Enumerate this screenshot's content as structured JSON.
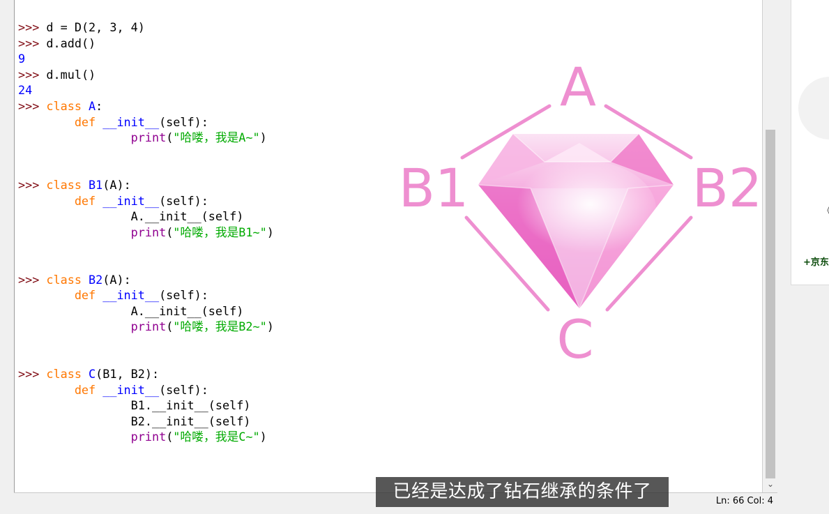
{
  "shell": {
    "prompt": ">>>",
    "lines": [
      {
        "parts": [
          {
            "t": "p",
            "s": ">>> "
          },
          {
            "t": "n",
            "s": "d = D(2, 3, 4)"
          }
        ]
      },
      {
        "parts": [
          {
            "t": "p",
            "s": ">>> "
          },
          {
            "t": "n",
            "s": "d.add()"
          }
        ]
      },
      {
        "parts": [
          {
            "t": "out",
            "s": "9"
          }
        ]
      },
      {
        "parts": [
          {
            "t": "p",
            "s": ">>> "
          },
          {
            "t": "n",
            "s": "d.mul()"
          }
        ]
      },
      {
        "parts": [
          {
            "t": "out",
            "s": "24"
          }
        ]
      },
      {
        "parts": [
          {
            "t": "p",
            "s": ">>> "
          },
          {
            "t": "kw",
            "s": "class "
          },
          {
            "t": "def",
            "s": "A"
          },
          {
            "t": "n",
            "s": ":"
          }
        ]
      },
      {
        "parts": [
          {
            "t": "n",
            "s": "        "
          },
          {
            "t": "kw",
            "s": "def "
          },
          {
            "t": "def",
            "s": "__init__"
          },
          {
            "t": "n",
            "s": "(self):"
          }
        ]
      },
      {
        "parts": [
          {
            "t": "n",
            "s": "                "
          },
          {
            "t": "bi",
            "s": "print"
          },
          {
            "t": "n",
            "s": "("
          },
          {
            "t": "str",
            "s": "\"哈喽，我是A~\""
          },
          {
            "t": "n",
            "s": ")"
          }
        ]
      },
      {
        "parts": []
      },
      {
        "parts": []
      },
      {
        "parts": [
          {
            "t": "p",
            "s": ">>> "
          },
          {
            "t": "kw",
            "s": "class "
          },
          {
            "t": "def",
            "s": "B1"
          },
          {
            "t": "n",
            "s": "(A):"
          }
        ]
      },
      {
        "parts": [
          {
            "t": "n",
            "s": "        "
          },
          {
            "t": "kw",
            "s": "def "
          },
          {
            "t": "def",
            "s": "__init__"
          },
          {
            "t": "n",
            "s": "(self):"
          }
        ]
      },
      {
        "parts": [
          {
            "t": "n",
            "s": "                A.__init__(self)"
          }
        ]
      },
      {
        "parts": [
          {
            "t": "n",
            "s": "                "
          },
          {
            "t": "bi",
            "s": "print"
          },
          {
            "t": "n",
            "s": "("
          },
          {
            "t": "str",
            "s": "\"哈喽，我是B1~\""
          },
          {
            "t": "n",
            "s": ")"
          }
        ]
      },
      {
        "parts": []
      },
      {
        "parts": []
      },
      {
        "parts": [
          {
            "t": "p",
            "s": ">>> "
          },
          {
            "t": "kw",
            "s": "class "
          },
          {
            "t": "def",
            "s": "B2"
          },
          {
            "t": "n",
            "s": "(A):"
          }
        ]
      },
      {
        "parts": [
          {
            "t": "n",
            "s": "        "
          },
          {
            "t": "kw",
            "s": "def "
          },
          {
            "t": "def",
            "s": "__init__"
          },
          {
            "t": "n",
            "s": "(self):"
          }
        ]
      },
      {
        "parts": [
          {
            "t": "n",
            "s": "                A.__init__(self)"
          }
        ]
      },
      {
        "parts": [
          {
            "t": "n",
            "s": "                "
          },
          {
            "t": "bi",
            "s": "print"
          },
          {
            "t": "n",
            "s": "("
          },
          {
            "t": "str",
            "s": "\"哈喽，我是B2~\""
          },
          {
            "t": "n",
            "s": ")"
          }
        ]
      },
      {
        "parts": []
      },
      {
        "parts": []
      },
      {
        "parts": [
          {
            "t": "p",
            "s": ">>> "
          },
          {
            "t": "kw",
            "s": "class "
          },
          {
            "t": "def",
            "s": "C"
          },
          {
            "t": "n",
            "s": "(B1, B2):"
          }
        ]
      },
      {
        "parts": [
          {
            "t": "n",
            "s": "        "
          },
          {
            "t": "kw",
            "s": "def "
          },
          {
            "t": "def",
            "s": "__init__"
          },
          {
            "t": "n",
            "s": "(self):"
          }
        ]
      },
      {
        "parts": [
          {
            "t": "n",
            "s": "                B1.__init__(self)"
          }
        ]
      },
      {
        "parts": [
          {
            "t": "n",
            "s": "                B2.__init__(self)"
          }
        ]
      },
      {
        "parts": [
          {
            "t": "n",
            "s": "                "
          },
          {
            "t": "bi",
            "s": "print"
          },
          {
            "t": "n",
            "s": "("
          },
          {
            "t": "str",
            "s": "\"哈喽，我是C~\""
          },
          {
            "t": "n",
            "s": ")"
          }
        ]
      },
      {
        "parts": []
      },
      {
        "parts": []
      },
      {
        "parts": []
      },
      {
        "parts": [
          {
            "t": "p",
            "s": ">>>"
          }
        ]
      }
    ]
  },
  "diagram": {
    "top": "A",
    "left": "B1",
    "right": "B2",
    "bottom": "C",
    "color": "#ee8fd0"
  },
  "subtitle": "已经是达成了钻石继承的条件了",
  "status": {
    "position": "Ln: 66  Col: 4"
  },
  "right_panel": {
    "glyph": "《",
    "label": "+京东"
  },
  "colors": {
    "prompt": "#7f0a12",
    "keyword": "#ff7700",
    "definition": "#0000ff",
    "string": "#00aa00",
    "builtin": "#900090",
    "output": "#0000ff"
  }
}
